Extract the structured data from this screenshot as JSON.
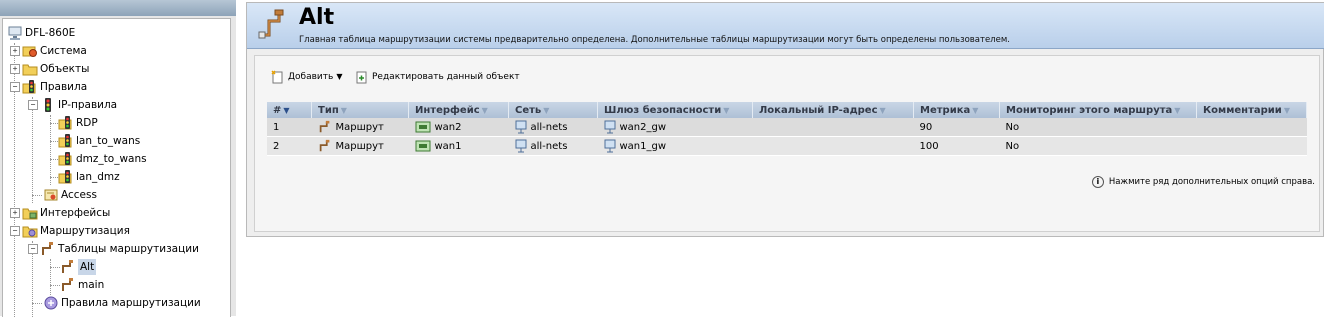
{
  "tree": {
    "root": "DFL-860E",
    "items": [
      {
        "label": "Система",
        "expander": "+"
      },
      {
        "label": "Объекты",
        "expander": "+"
      },
      {
        "label": "Правила",
        "expander": "−"
      },
      {
        "label": "IP-правила",
        "expander": "−"
      },
      {
        "label": "RDP"
      },
      {
        "label": "lan_to_wans"
      },
      {
        "label": "dmz_to_wans"
      },
      {
        "label": "lan_dmz"
      },
      {
        "label": "Access"
      },
      {
        "label": "Интерфейсы",
        "expander": "+"
      },
      {
        "label": "Маршрутизация",
        "expander": "−"
      },
      {
        "label": "Таблицы маршрутизации",
        "expander": "−"
      },
      {
        "label": "Alt",
        "selected": true
      },
      {
        "label": "main"
      },
      {
        "label": "Правила маршрутизации"
      }
    ]
  },
  "header": {
    "title": "Alt",
    "description": "Главная таблица маршрутизации системы предварительно определена. Дополнительные таблицы маршрутизации могут быть определены пользователем."
  },
  "toolbar": {
    "add_label": "Добавить",
    "edit_label": "Редактировать данный объект"
  },
  "table": {
    "columns": [
      "#",
      "Тип",
      "Интерфейс",
      "Сеть",
      "Шлюз безопасности",
      "Локальный IP-адрес",
      "Метрика",
      "Мониторинг этого маршрута",
      "Комментарии"
    ],
    "rows": [
      {
        "num": "1",
        "type": "Маршрут",
        "interface": "wan2",
        "network": "all-nets",
        "gateway": "wan2_gw",
        "local_ip": "",
        "metric": "90",
        "monitor": "No",
        "comment": ""
      },
      {
        "num": "2",
        "type": "Маршрут",
        "interface": "wan1",
        "network": "all-nets",
        "gateway": "wan1_gw",
        "local_ip": "",
        "metric": "100",
        "monitor": "No",
        "comment": ""
      }
    ]
  },
  "hint": "Нажмите ряд дополнительных опций справа.",
  "colors": {
    "header_bg": "#c7d9ef",
    "row_odd": "#dcdcdc",
    "row_even": "#e6e6e6",
    "column_header": "#b9c9dd"
  }
}
